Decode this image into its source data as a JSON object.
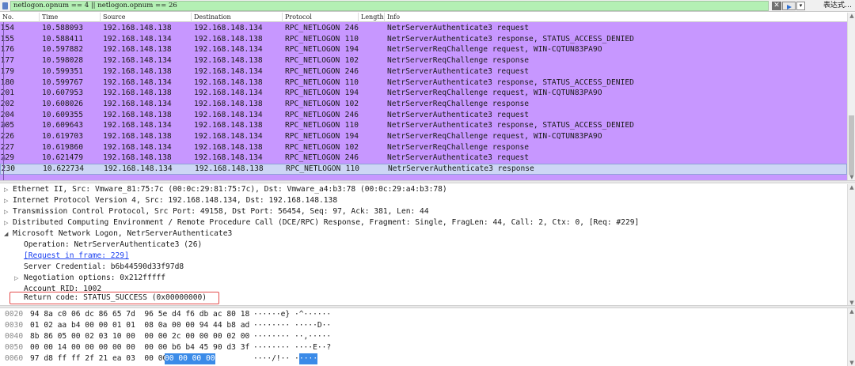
{
  "filter": {
    "value": "netlogon.opnum == 4 || netlogon.opnum == 26",
    "clear_label": "✕",
    "drop_label": "▾",
    "expression_label": "表达式…"
  },
  "columns": [
    "No.",
    "Time",
    "Source",
    "Destination",
    "Protocol",
    "Length",
    "Info"
  ],
  "packets": [
    {
      "no": "154",
      "time": "10.588093",
      "src": "192.168.148.138",
      "dst": "192.168.148.134",
      "proto": "RPC_NETLOGON",
      "len": "246",
      "info": "NetrServerAuthenticate3 request"
    },
    {
      "no": "155",
      "time": "10.588411",
      "src": "192.168.148.134",
      "dst": "192.168.148.138",
      "proto": "RPC_NETLOGON",
      "len": "110",
      "info": "NetrServerAuthenticate3 response, STATUS_ACCESS_DENIED"
    },
    {
      "no": "176",
      "time": "10.597882",
      "src": "192.168.148.138",
      "dst": "192.168.148.134",
      "proto": "RPC_NETLOGON",
      "len": "194",
      "info": "NetrServerReqChallenge request, WIN-CQTUN83PA9O"
    },
    {
      "no": "177",
      "time": "10.598028",
      "src": "192.168.148.134",
      "dst": "192.168.148.138",
      "proto": "RPC_NETLOGON",
      "len": "102",
      "info": "NetrServerReqChallenge response"
    },
    {
      "no": "179",
      "time": "10.599351",
      "src": "192.168.148.138",
      "dst": "192.168.148.134",
      "proto": "RPC_NETLOGON",
      "len": "246",
      "info": "NetrServerAuthenticate3 request"
    },
    {
      "no": "180",
      "time": "10.599767",
      "src": "192.168.148.134",
      "dst": "192.168.148.138",
      "proto": "RPC_NETLOGON",
      "len": "110",
      "info": "NetrServerAuthenticate3 response, STATUS_ACCESS_DENIED"
    },
    {
      "no": "201",
      "time": "10.607953",
      "src": "192.168.148.138",
      "dst": "192.168.148.134",
      "proto": "RPC_NETLOGON",
      "len": "194",
      "info": "NetrServerReqChallenge request, WIN-CQTUN83PA9O"
    },
    {
      "no": "202",
      "time": "10.608026",
      "src": "192.168.148.134",
      "dst": "192.168.148.138",
      "proto": "RPC_NETLOGON",
      "len": "102",
      "info": "NetrServerReqChallenge response"
    },
    {
      "no": "204",
      "time": "10.609355",
      "src": "192.168.148.138",
      "dst": "192.168.148.134",
      "proto": "RPC_NETLOGON",
      "len": "246",
      "info": "NetrServerAuthenticate3 request"
    },
    {
      "no": "205",
      "time": "10.609643",
      "src": "192.168.148.134",
      "dst": "192.168.148.138",
      "proto": "RPC_NETLOGON",
      "len": "110",
      "info": "NetrServerAuthenticate3 response, STATUS_ACCESS_DENIED"
    },
    {
      "no": "226",
      "time": "10.619703",
      "src": "192.168.148.138",
      "dst": "192.168.148.134",
      "proto": "RPC_NETLOGON",
      "len": "194",
      "info": "NetrServerReqChallenge request, WIN-CQTUN83PA9O"
    },
    {
      "no": "227",
      "time": "10.619860",
      "src": "192.168.148.134",
      "dst": "192.168.148.138",
      "proto": "RPC_NETLOGON",
      "len": "102",
      "info": "NetrServerReqChallenge response"
    },
    {
      "no": "229",
      "time": "10.621479",
      "src": "192.168.148.138",
      "dst": "192.168.148.134",
      "proto": "RPC_NETLOGON",
      "len": "246",
      "info": "NetrServerAuthenticate3 request"
    },
    {
      "no": "230",
      "time": "10.622734",
      "src": "192.168.148.134",
      "dst": "192.168.148.138",
      "proto": "RPC_NETLOGON",
      "len": "110",
      "info": "NetrServerAuthenticate3 response"
    }
  ],
  "detail": {
    "ethernet": "Ethernet II, Src: Vmware_81:75:7c (00:0c:29:81:75:7c), Dst: Vmware_a4:b3:78 (00:0c:29:a4:b3:78)",
    "ip": "Internet Protocol Version 4, Src: 192.168.148.134, Dst: 192.168.148.138",
    "tcp": "Transmission Control Protocol, Src Port: 49158, Dst Port: 56454, Seq: 97, Ack: 381, Len: 44",
    "dcerpc": "Distributed Computing Environment / Remote Procedure Call (DCE/RPC) Response, Fragment: Single, FragLen: 44, Call: 2, Ctx: 0, [Req: #229]",
    "netlogon": "Microsoft Network Logon, NetrServerAuthenticate3",
    "operation": "Operation: NetrServerAuthenticate3 (26)",
    "request_link": "[Request in frame: 229]",
    "credential": "Server Credential: b6b44590d33f97d8",
    "negotiation": "Negotiation options: 0x212fffff",
    "rid": "Account RID: 1002",
    "return_code": "Return code: STATUS_SUCCESS (0x00000000)"
  },
  "hex": [
    {
      "offset": "0020",
      "bytes": "94 8a c0 06 dc 86 65 7d  96 5e d4 f6 db ac 80 18",
      "ascii": "······e} ·^······"
    },
    {
      "offset": "0030",
      "bytes": "01 02 aa b4 00 00 01 01  08 0a 00 00 94 44 b8 ad",
      "ascii": "········ ·····D··"
    },
    {
      "offset": "0040",
      "bytes": "8b 86 05 00 02 03 10 00  00 00 2c 00 00 00 02 00",
      "ascii": "········ ··,·····"
    },
    {
      "offset": "0050",
      "bytes": "00 00 14 00 00 00 00 00  00 00 b6 b4 45 90 d3 3f",
      "ascii": "········ ····E··?"
    },
    {
      "offset": "0060",
      "bytes": "97 d8 ff ff 2f 21 ea 03  00 00 ",
      "bytes_sel": "00 00 00 00",
      "ascii": "····/!·· ··",
      "ascii_sel": "····"
    }
  ],
  "colors": {
    "row_bg": "#c797ff",
    "selected_row": "#cdd6f5",
    "filter_ok": "#b4f0b4",
    "highlight_box": "#e34c4c",
    "hex_selection": "#3b8be8"
  }
}
